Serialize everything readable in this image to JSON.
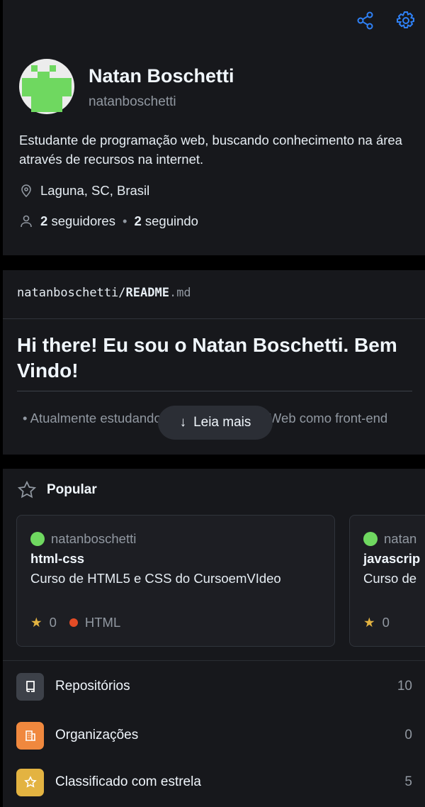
{
  "profile": {
    "name": "Natan Boschetti",
    "login": "natanboschetti",
    "bio": "Estudante de programação web, buscando conhecimento na área através de recursos na internet.",
    "location": "Laguna, SC, Brasil",
    "followers": "2",
    "followers_label": "seguidores",
    "following": "2",
    "following_label": "seguindo"
  },
  "readme": {
    "path_user": "natanboschetti/",
    "path_file": "README",
    "path_ext": ".md",
    "heading": "Hi there! Eu sou o Natan Boschetti. Bem Vindo!",
    "item": "Atualmente estudando Desenvolvimento Web como front-end",
    "more_label": "Leia mais"
  },
  "popular": {
    "title": "Popular",
    "cards": [
      {
        "owner": "natanboschetti",
        "name": "html-css",
        "desc": "Curso de HTML5 e CSS do CursoemVIdeo",
        "stars": "0",
        "lang": "HTML",
        "lang_color": "#e34c26"
      },
      {
        "owner": "natan",
        "name": "javascrip",
        "desc": "Curso de",
        "stars": "0"
      }
    ]
  },
  "menu": [
    {
      "label": "Repositórios",
      "count": "10",
      "color": "#3d4149"
    },
    {
      "label": "Organizações",
      "count": "0",
      "color": "#f0883e"
    },
    {
      "label": "Classificado com estrela",
      "count": "5",
      "color": "#e3b341"
    }
  ],
  "colors": {
    "accent": "#2f81f7",
    "avatar": "#6fd860"
  }
}
